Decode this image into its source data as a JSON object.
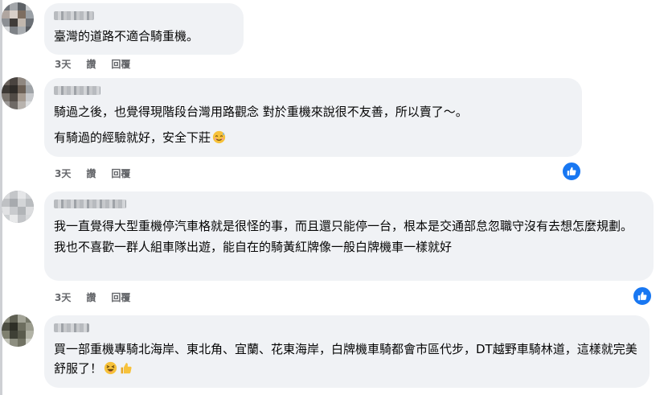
{
  "comments": [
    {
      "lines": [
        "臺灣的道路不適合騎重機。"
      ],
      "time": "3天",
      "like": "讚",
      "reply": "回覆"
    },
    {
      "lines": [
        "騎過之後，也覺得現階段台灣用路觀念 對於重機來說很不友善，所以賣了～。",
        "有騎過的經驗就好，安全下莊"
      ],
      "time": "3天",
      "like": "讚",
      "reply": "回覆"
    },
    {
      "lines": [
        "我一直覺得大型重機停汽車格就是很怪的事，而且還只能停一台，根本是交通部怠忽職守沒有去想怎麼規劃。我也不喜歡一群人組車隊出遊，能自在的騎黃紅牌像一般白牌機車一樣就好"
      ],
      "time": "3天",
      "like": "讚",
      "reply": "回覆"
    },
    {
      "lines": [
        "買一部重機專騎北海岸、東北角、宜蘭、花東海岸，白牌機車騎都會市區代步，DT越野車騎林道，這樣就完美舒服了！"
      ]
    }
  ],
  "icons": {
    "like_reaction": "thumbs-up-icon",
    "emoji_sweat": "face-with-sweat-icon",
    "emoji_grin": "grinning-squinting-face-icon",
    "emoji_thumb": "thumbs-up-emoji-icon"
  },
  "colors": {
    "bubble": "#f0f2f5",
    "action_text": "#65676b",
    "like_blue": "#1877f2"
  }
}
